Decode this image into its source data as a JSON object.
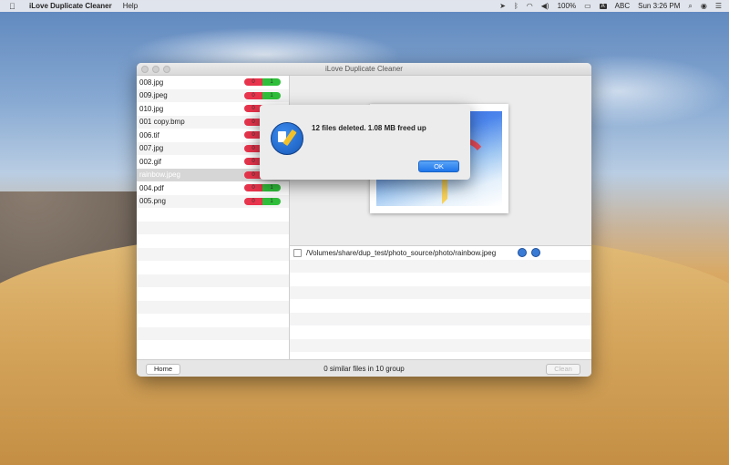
{
  "menubar": {
    "app_name": "iLove Duplicate Cleaner",
    "menus": [
      "Help"
    ],
    "battery": "100%",
    "input_source": "ABC",
    "clock": "Sun 3:26 PM"
  },
  "window": {
    "title": "iLove Duplicate Cleaner",
    "files": [
      {
        "name": "008.jpg",
        "dupes": "0",
        "keep": "1",
        "selected": false
      },
      {
        "name": "009.jpeg",
        "dupes": "0",
        "keep": "1",
        "selected": false
      },
      {
        "name": "010.jpg",
        "dupes": "0",
        "keep": "1",
        "selected": false
      },
      {
        "name": "001 copy.bmp",
        "dupes": "0",
        "keep": "1",
        "selected": false
      },
      {
        "name": "006.tif",
        "dupes": "0",
        "keep": "1",
        "selected": false
      },
      {
        "name": "007.jpg",
        "dupes": "0",
        "keep": "1",
        "selected": false
      },
      {
        "name": "002.gif",
        "dupes": "0",
        "keep": "1",
        "selected": false
      },
      {
        "name": "rainbow.jpeg",
        "dupes": "0",
        "keep": "1",
        "selected": true
      },
      {
        "name": "004.pdf",
        "dupes": "0",
        "keep": "1",
        "selected": false
      },
      {
        "name": "005.png",
        "dupes": "0",
        "keep": "1",
        "selected": false
      }
    ],
    "path_row": "/Volumes/share/dup_test/photo_source/photo/rainbow.jpeg",
    "home_label": "Home",
    "status": "0 similar files in 10 group",
    "clean_label": "Clean"
  },
  "dialog": {
    "message": "12 files deleted. 1.08 MB freed up",
    "ok_label": "OK"
  },
  "colors": {
    "dupe_pill": "#e8344c",
    "keep_pill": "#2fbf3a",
    "accent": "#1e76ea"
  }
}
